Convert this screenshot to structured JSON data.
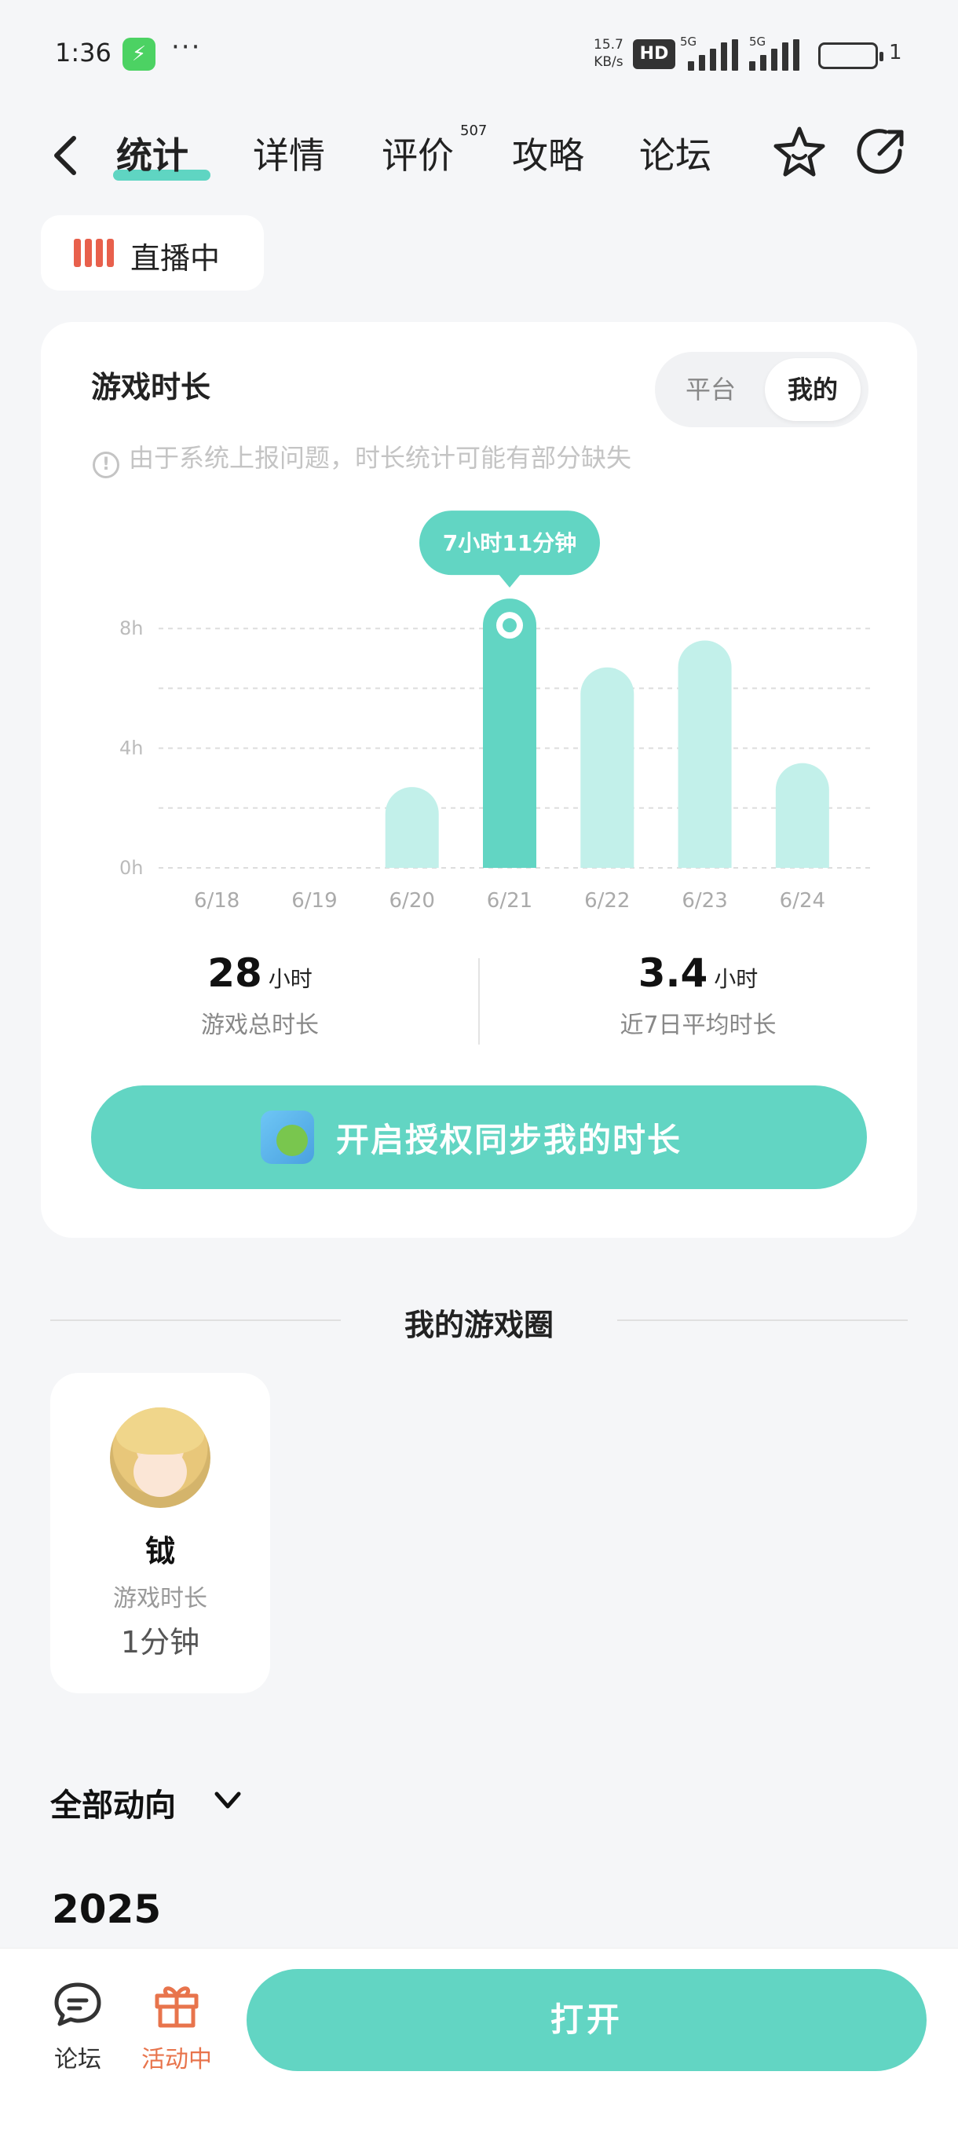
{
  "status_bar": {
    "time": "1:36",
    "network_speed_value": "15.7",
    "network_speed_unit": "KB/s",
    "hd_label": "HD",
    "signal_1_label": "5G",
    "signal_2_label": "5G",
    "battery_percent": "1"
  },
  "nav": {
    "tabs": [
      {
        "label": "统计",
        "active": true
      },
      {
        "label": "详情",
        "active": false
      },
      {
        "label": "评价",
        "active": false,
        "badge": "507"
      },
      {
        "label": "攻略",
        "active": false
      },
      {
        "label": "论坛",
        "active": false
      }
    ],
    "icons": [
      "back-icon",
      "star-icon",
      "share-icon"
    ]
  },
  "live_chip": {
    "label": "直播中"
  },
  "stats_card": {
    "title": "游戏时长",
    "segmented": {
      "options": [
        "平台",
        "我的"
      ],
      "selected": "我的"
    },
    "notice": "由于系统上报问题，时长统计可能有部分缺失",
    "tooltip": "7小时11分钟",
    "summary": {
      "total": {
        "value": "28",
        "unit": "小时",
        "label": "游戏总时长"
      },
      "average": {
        "value": "3.4",
        "unit": "小时",
        "label": "近7日平均时长"
      }
    },
    "sync_button_label": "开启授权同步我的时长"
  },
  "chart_data": {
    "type": "bar",
    "categories": [
      "6/18",
      "6/19",
      "6/20",
      "6/21",
      "6/22",
      "6/23",
      "6/24"
    ],
    "values": [
      0,
      0,
      2.7,
      9.0,
      6.7,
      7.6,
      3.5
    ],
    "highlighted_index": 3,
    "y_ticks": [
      "0h",
      "4h",
      "8h"
    ],
    "ylim": [
      0,
      10.5
    ],
    "grid": true,
    "colors": {
      "highlight": "#62d5c3",
      "normal": "#c2f0ea",
      "grid": "#dddddd",
      "tooltip": "#62d5c3"
    }
  },
  "game_circle": {
    "title": "我的游戏圈",
    "members": [
      {
        "name": "钺",
        "label": "游戏时长",
        "value": "1分钟"
      }
    ]
  },
  "filter": {
    "label": "全部动向"
  },
  "timeline": {
    "year": "2025"
  },
  "bottom_bar": {
    "items": [
      {
        "label": "论坛",
        "icon": "chat-icon",
        "color": "#333333"
      },
      {
        "label": "活动中",
        "icon": "gift-icon",
        "color": "#e8744c"
      }
    ],
    "open_button_label": "打开"
  }
}
